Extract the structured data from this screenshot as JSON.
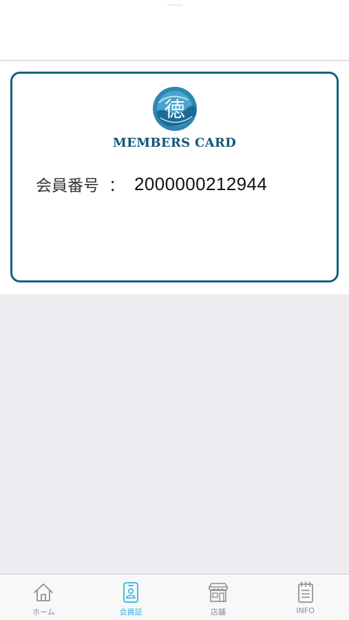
{
  "card": {
    "logo_kanji": "徳",
    "logo_title": "MEMBERS CARD",
    "member_label": "会員番号",
    "colon": "：",
    "member_number": "2000000212944"
  },
  "tabs": [
    {
      "label": "ホーム",
      "icon": "home-icon",
      "active": false
    },
    {
      "label": "会員証",
      "icon": "member-card-icon",
      "active": true
    },
    {
      "label": "店舗",
      "icon": "store-icon",
      "active": false
    },
    {
      "label": "INFO",
      "icon": "info-notepad-icon",
      "active": false
    }
  ],
  "colors": {
    "card_border": "#10607e",
    "logo_text": "#11577a",
    "tab_active": "#29b5e6",
    "tab_inactive": "#8e8e93",
    "background": "#ededf1"
  }
}
